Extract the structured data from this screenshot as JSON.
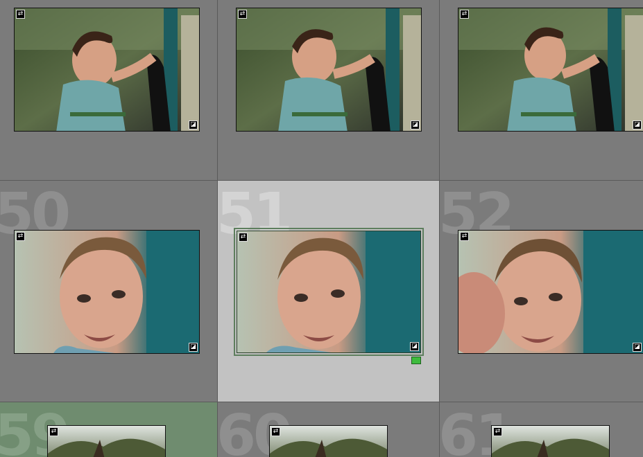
{
  "cells": [
    {
      "number": "",
      "state": "normal"
    },
    {
      "number": "",
      "state": "normal"
    },
    {
      "number": "",
      "state": "normal"
    },
    {
      "number": "50",
      "state": "normal"
    },
    {
      "number": "51",
      "state": "selected",
      "label_color": "#3dbb3d"
    },
    {
      "number": "52",
      "state": "normal"
    },
    {
      "number": "59",
      "state": "green"
    },
    {
      "number": "60",
      "state": "normal"
    },
    {
      "number": "61",
      "state": "normal"
    }
  ],
  "icons": {
    "top_left": "sync-arrows-icon",
    "bottom_right": "edit-adjustment-icon"
  },
  "colors": {
    "cell_bg": "#7b7b7b",
    "selected_bg": "#c2c2c2",
    "green_bg": "#6f8c6f",
    "label_green": "#3dbb3d"
  }
}
